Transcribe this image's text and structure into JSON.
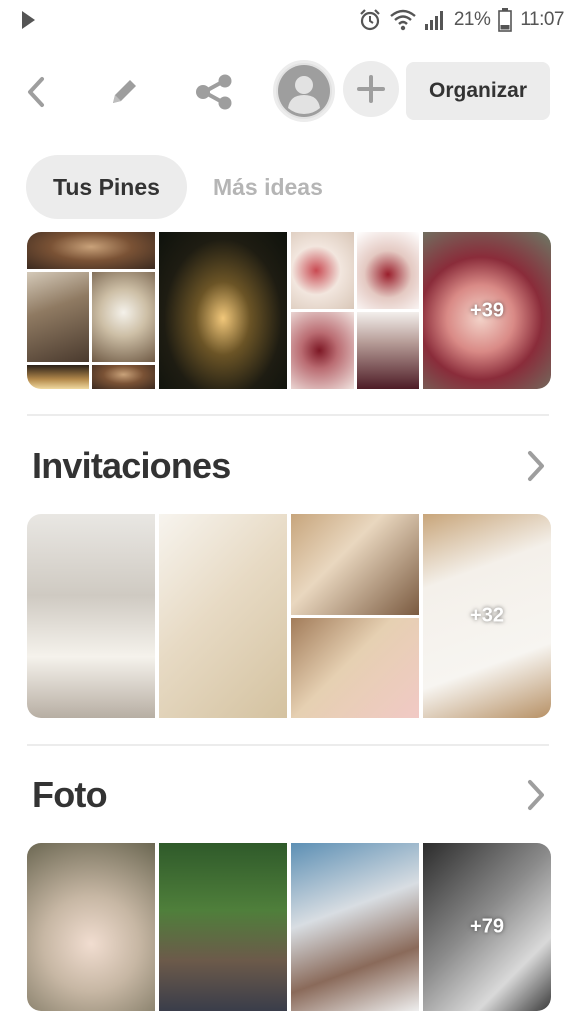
{
  "status_bar": {
    "battery": "21%",
    "time": "11:07",
    "icons": [
      "play-icon",
      "alarm-icon",
      "wifi-icon",
      "signal-icon",
      "battery-icon"
    ]
  },
  "toolbar": {
    "back_icon": "back-icon",
    "edit_icon": "pencil-icon",
    "share_icon": "share-icon",
    "avatar_icon": "user-icon",
    "add_icon": "plus-icon",
    "organize_label": "Organizar"
  },
  "tabs": [
    {
      "label": "Tus Pines",
      "active": true
    },
    {
      "label": "Más ideas",
      "active": false
    }
  ],
  "sections": [
    {
      "title": "",
      "more_count": "+39"
    },
    {
      "title": "Invitaciones",
      "more_count": "+32"
    },
    {
      "title": "Foto",
      "more_count": "+79"
    }
  ],
  "colors": {
    "text": "#333333",
    "muted_text": "#b5b5b5",
    "pill_bg": "#ececec",
    "divider": "#ececec",
    "icon": "#9e9e9e"
  }
}
